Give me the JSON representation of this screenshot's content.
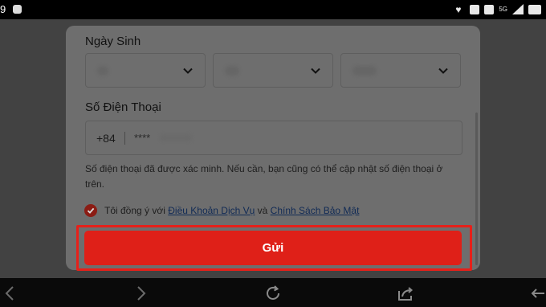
{
  "status_bar": {
    "time": "9",
    "sim_badge": "5G",
    "icons": [
      "app-icon",
      "heart-icon",
      "alarm-icon",
      "mute-icon",
      "signal-icon",
      "battery-icon"
    ]
  },
  "form": {
    "dob_label": "Ngày Sinh",
    "phone_label": "Số Điện Thoại",
    "phone_prefix": "+84",
    "phone_value": "****",
    "note": "Số điện thoại đã được xác minh. Nếu cần, bạn cũng có thể cập nhật số điện thoại ở trên.",
    "agree_prefix": "Tôi đồng ý với ",
    "terms_link": "Điều Khoản Dịch Vụ",
    "agree_and": " và ",
    "privacy_link": "Chính Sách Bảo Mật",
    "agree_checked": true,
    "submit_label": "Gửi"
  },
  "colors": {
    "accent": "#df2018",
    "highlight_outline": "#e6201a",
    "link": "#102a55"
  },
  "browser_bar": {
    "icons": [
      "back-arrow-icon",
      "forward-arrow-icon",
      "reload-icon",
      "share-icon",
      "exit-icon"
    ]
  }
}
